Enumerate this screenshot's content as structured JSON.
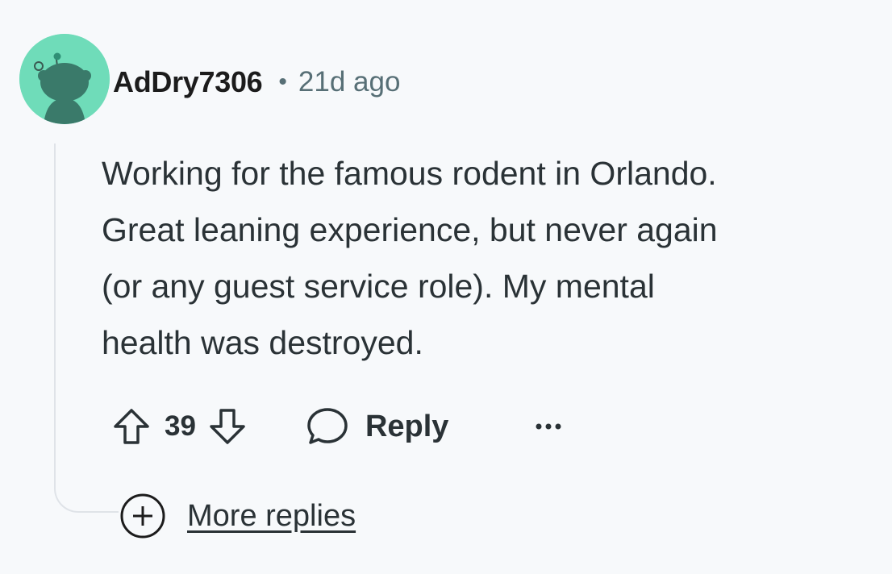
{
  "comment": {
    "username": "AdDry7306",
    "separator": "•",
    "timestamp": "21d ago",
    "body_lines": [
      "Working for the famous rodent in Orlando.",
      "Great leaning experience, but never again",
      "(or any guest service role). My mental",
      "health was destroyed."
    ],
    "score": "39",
    "reply_label": "Reply",
    "more_replies_label": "More replies"
  },
  "icons": {
    "avatar": "reddit-snoo-avatar",
    "upvote": "upvote-arrow-icon",
    "downvote": "downvote-arrow-icon",
    "reply": "speech-bubble-icon",
    "more": "ellipsis-icon",
    "expand": "plus-circle-icon"
  },
  "colors": {
    "background": "#f7f9fb",
    "avatar_bg": "#6fdcb9",
    "text": "#2a3236",
    "meta": "#576f76"
  }
}
